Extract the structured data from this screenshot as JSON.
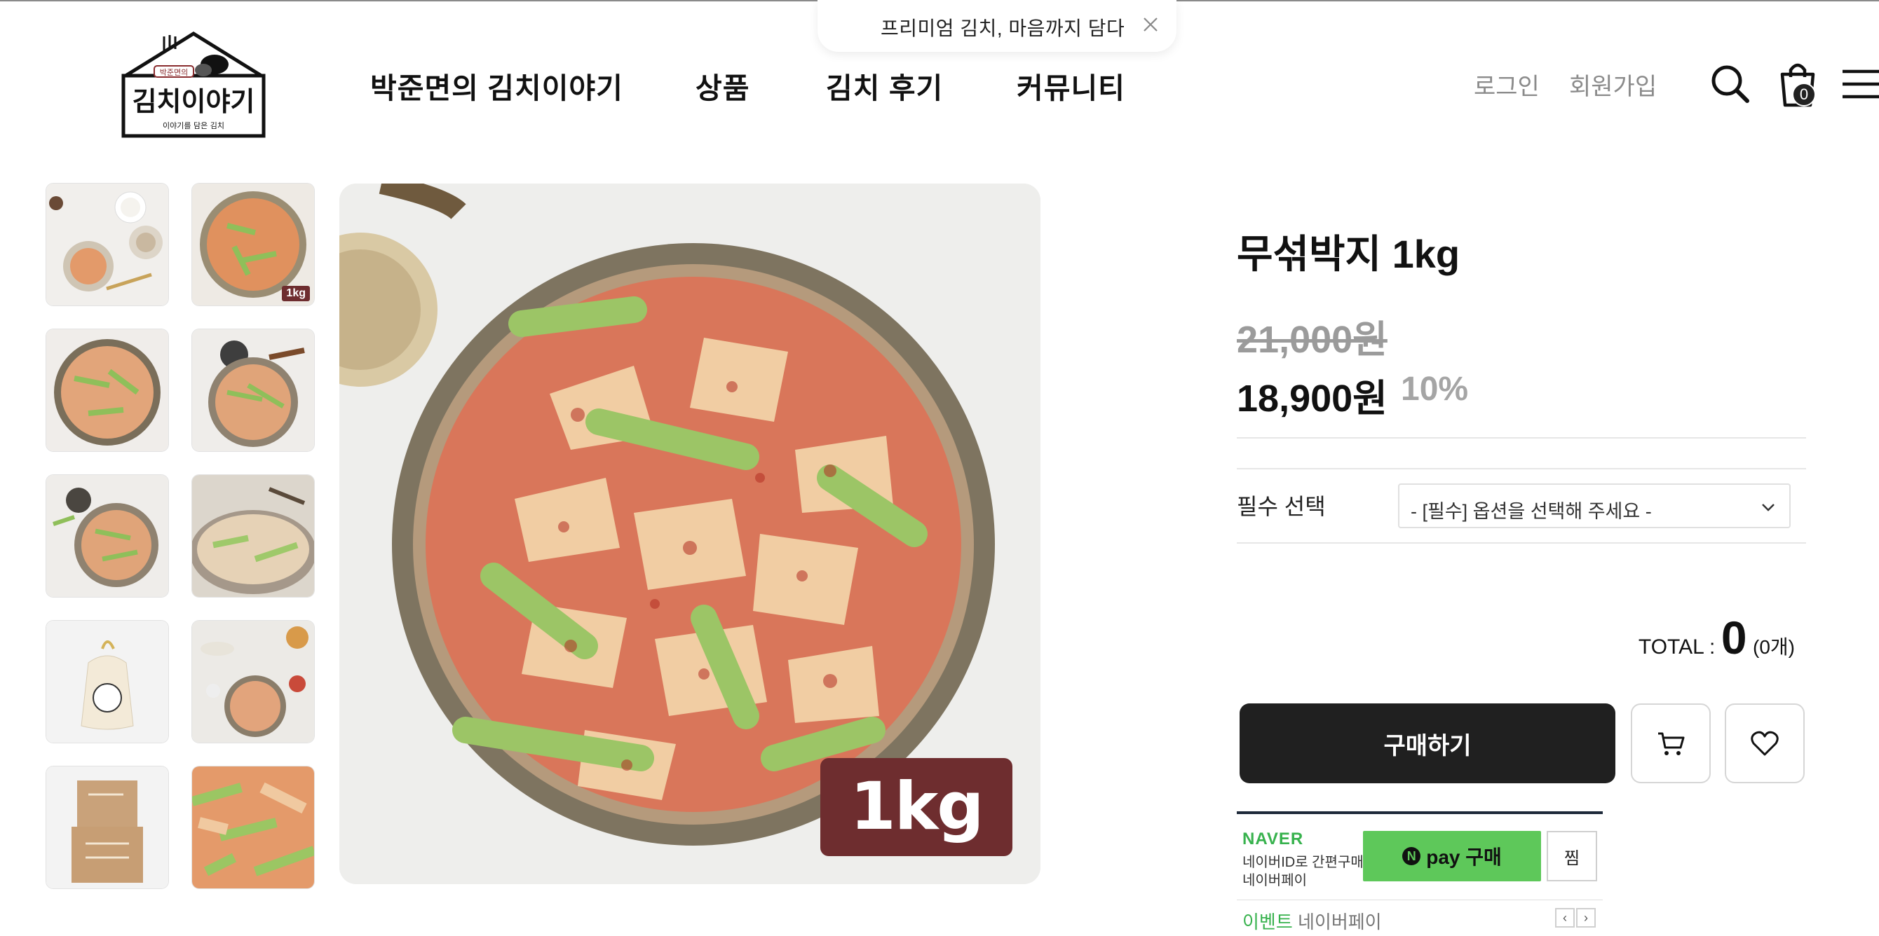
{
  "promo": {
    "text": "프리미엄 김치, 마음까지 담다"
  },
  "logo": {
    "name": "김치이야기",
    "sub": "이야기를 담은 김치",
    "tag": "박준면의"
  },
  "nav": {
    "items": [
      "박준면의 김치이야기",
      "상품",
      "김치 후기",
      "커뮤니티"
    ]
  },
  "auth": {
    "login": "로그인",
    "signup": "회원가입"
  },
  "cart": {
    "count": "0"
  },
  "thumbnails": {
    "tag": "1kg"
  },
  "main_image": {
    "badge": "1kg"
  },
  "product": {
    "title": "무섞박지 1kg",
    "original_price": "21,000원",
    "price": "18,900원",
    "discount": "10%"
  },
  "option": {
    "label": "필수 선택",
    "selected": "- [필수] 옵션을 선택해 주세요 -"
  },
  "total": {
    "label": "TOTAL :",
    "amount": "0",
    "count": "(0개)"
  },
  "actions": {
    "buy": "구매하기"
  },
  "npay": {
    "logo": "NAVER",
    "desc1": "네이버ID로 간편구매",
    "desc2": "네이버페이",
    "n": "N",
    "button": "pay 구매",
    "zzim": "찜",
    "event": "이벤트",
    "event_sub": "네이버페이",
    "prev": "‹",
    "next": "›"
  },
  "colors": {
    "accent_dark": "#202020",
    "badge_maroon": "#6e2d2f",
    "npay_green": "#5ec85a",
    "muted_gray": "#9b9b9b"
  }
}
